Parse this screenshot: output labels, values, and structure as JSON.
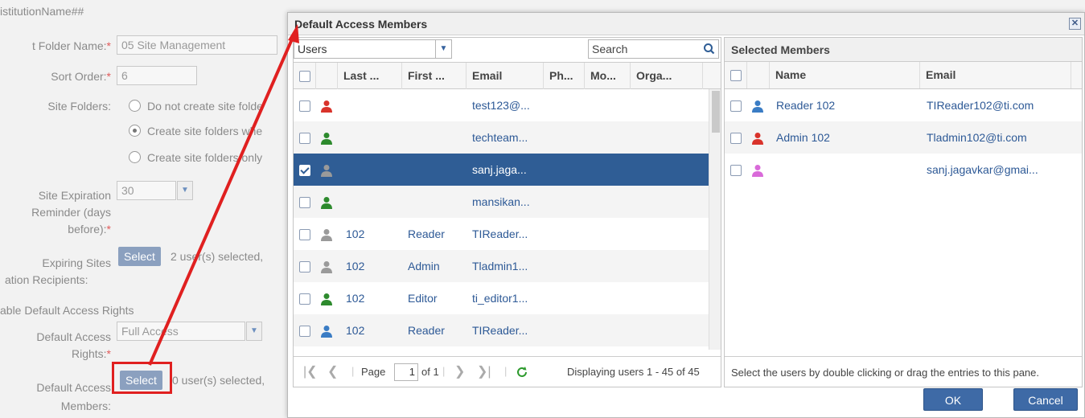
{
  "background_form": {
    "institution": "istitutionName##",
    "folder_name_label": "t Folder Name:",
    "folder_name_value": "05 Site Management",
    "sort_order_label": "Sort Order:",
    "sort_order_value": "6",
    "site_folders_label": "Site Folders:",
    "site_folder_opt1": "Do not create site folde",
    "site_folder_opt2": "Create site folders whe",
    "site_folder_opt3": "Create site folders only",
    "site_expiration_label_1": "Site Expiration",
    "site_expiration_label_2": "Reminder (days",
    "site_expiration_label_3": "before):",
    "site_expiration_value": "30",
    "expiring_sites_label_1": "Expiring Sites",
    "expiring_sites_label_2": "ation Recipients:",
    "select_button": "Select",
    "expiring_selected_text": "2 user(s) selected,",
    "enable_default_rights": "able Default Access Rights",
    "default_access_rights_label_1": "Default Access",
    "default_access_rights_label_2": "Rights:",
    "default_access_rights_value": "Full Access",
    "default_access_members_label_1": "Default Access",
    "default_access_members_label_2": "Members:",
    "members_selected_text": "0 user(s) selected,",
    "required_mark": "*"
  },
  "dialog": {
    "title": "Default Access Members",
    "close_icon": "close-icon",
    "user_type_value": "Users",
    "search_placeholder": "Search",
    "left_columns": [
      "Last ...",
      "First ...",
      "Email",
      "Ph...",
      "Mo...",
      "Orga..."
    ],
    "left_rows": [
      {
        "last": "",
        "first": "",
        "email": "test123@...",
        "icon_color": "#d9332b",
        "checked": false,
        "selected": false
      },
      {
        "last": "",
        "first": "",
        "email": "techteam...",
        "icon_color": "#2d8a2d",
        "checked": false,
        "selected": false
      },
      {
        "last": "",
        "first": "",
        "email": "sanj.jaga...",
        "icon_color": "#9a9a9a",
        "checked": true,
        "selected": true
      },
      {
        "last": "",
        "first": "",
        "email": "mansikan...",
        "icon_color": "#2d8a2d",
        "checked": false,
        "selected": false
      },
      {
        "last": "102",
        "first": "Reader",
        "email": "TIReader...",
        "icon_color": "#9a9a9a",
        "checked": false,
        "selected": false
      },
      {
        "last": "102",
        "first": "Admin",
        "email": "Tladmin1...",
        "icon_color": "#9a9a9a",
        "checked": false,
        "selected": false
      },
      {
        "last": "102",
        "first": "Editor",
        "email": "ti_editor1...",
        "icon_color": "#2d8a2d",
        "checked": false,
        "selected": false
      },
      {
        "last": "102",
        "first": "Reader",
        "email": "TIReader...",
        "icon_color": "#3a7cc4",
        "checked": false,
        "selected": false
      }
    ],
    "pager": {
      "page_label": "Page",
      "page_value": "1",
      "of_text": "of 1",
      "display_text": "Displaying users 1 - 45 of 45"
    },
    "right_title": "Selected Members",
    "right_columns": [
      "Name",
      "Email"
    ],
    "right_rows": [
      {
        "name": "Reader 102",
        "email": "TIReader102@ti.com",
        "icon_color": "#3a7cc4"
      },
      {
        "name": "Admin 102",
        "email": "Tladmin102@ti.com",
        "icon_color": "#d9332b"
      },
      {
        "name": "",
        "email": "sanj.jagavkar@gmai...",
        "icon_color": "#d96ad9"
      }
    ],
    "right_footer": "Select the users by double clicking or drag the entries to this pane.",
    "ok_label": "OK",
    "cancel_label": "Cancel"
  },
  "colors": {
    "accent": "#2f5d95",
    "annotation": "#e02020"
  }
}
